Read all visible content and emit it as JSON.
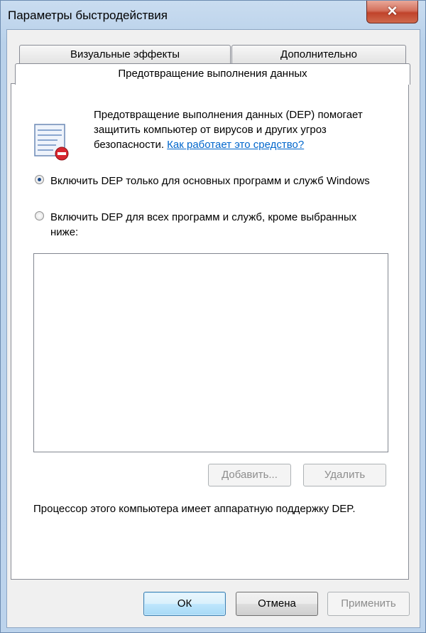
{
  "window": {
    "title": "Параметры быстродействия",
    "close_symbol": "✕"
  },
  "tabs": [
    {
      "label": "Визуальные эффекты",
      "active": false
    },
    {
      "label": "Дополнительно",
      "active": false
    },
    {
      "label": "Предотвращение выполнения данных",
      "active": true
    }
  ],
  "dep": {
    "icon": "dep-shield-icon",
    "description": "Предотвращение выполнения данных (DEP) помогает защитить компьютер от вирусов и других угроз безопасности.",
    "link_text": "Как работает это средство?",
    "options": [
      {
        "label": "Включить DEP только для основных программ и служб Windows",
        "checked": true
      },
      {
        "label": "Включить DEP для всех программ и служб, кроме выбранных ниже:",
        "checked": false
      }
    ],
    "add_label": "Добавить...",
    "remove_label": "Удалить",
    "hw_support_text": "Процессор этого компьютера имеет аппаратную поддержку DEP."
  },
  "footer": {
    "ok_label": "ОК",
    "cancel_label": "Отмена",
    "apply_label": "Применить"
  },
  "colors": {
    "link": "#0066cc",
    "close_button": "#c0432b",
    "default_button_border": "#3c7fb1"
  }
}
